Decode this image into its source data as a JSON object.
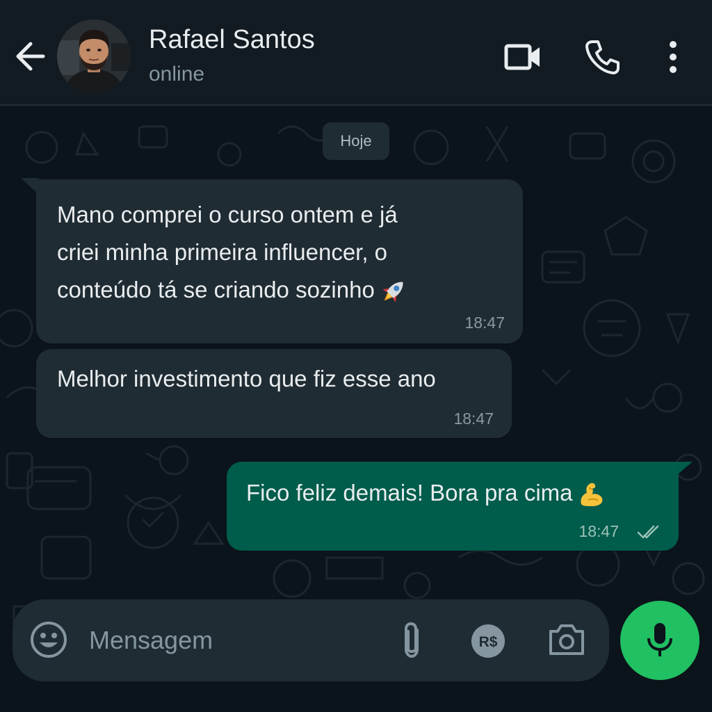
{
  "header": {
    "contact_name": "Rafael Santos",
    "status": "online",
    "icons": {
      "back": "arrow-left-icon",
      "video": "video-camera-icon",
      "call": "phone-icon",
      "menu": "more-vertical-icon"
    }
  },
  "chat": {
    "date_label": "Hoje",
    "messages": [
      {
        "direction": "incoming",
        "lines": [
          "Mano comprei o curso ontem e já",
          "criei minha primeira influencer, o",
          "conteúdo tá se criando sozinho"
        ],
        "emoji": "rocket",
        "time": "18:47"
      },
      {
        "direction": "incoming",
        "lines": [
          "Melhor investimento que fiz esse ano"
        ],
        "time": "18:47"
      },
      {
        "direction": "outgoing",
        "lines": [
          "Fico feliz demais! Bora pra cima"
        ],
        "emoji": "flexed-biceps",
        "time": "18:47",
        "status": "read"
      }
    ]
  },
  "composer": {
    "placeholder": "Mensagem",
    "pay_label": "R$",
    "icons": [
      "smiley-icon",
      "paperclip-icon",
      "payment-icon",
      "camera-icon",
      "microphone-icon"
    ]
  },
  "colors": {
    "header_bg": "#121b22",
    "chat_bg": "#0b141a",
    "incoming_bubble": "#202c33",
    "outgoing_bubble": "#005c4b",
    "accent_green": "#21c063",
    "read_ticks": "#9cc2b7"
  }
}
